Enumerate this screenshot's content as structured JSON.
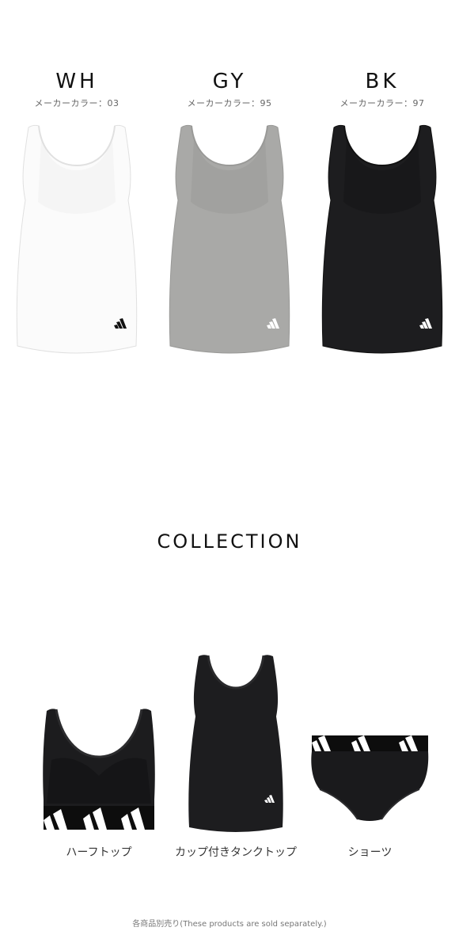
{
  "colors": [
    {
      "code": "WH",
      "maker_color": "メーカーカラー：03",
      "fill": "#fbfbfb",
      "inner": "#f2f2f2",
      "stroke": "#e0e0e0",
      "logo": "#111111"
    },
    {
      "code": "GY",
      "maker_color": "メーカーカラー：95",
      "fill": "#a9a9a7",
      "inner": "#9c9c9a",
      "stroke": "#999997",
      "logo": "#ffffff"
    },
    {
      "code": "BK",
      "maker_color": "メーカーカラー：97",
      "fill": "#1d1d1f",
      "inner": "#151517",
      "stroke": "#111111",
      "logo": "#ffffff"
    }
  ],
  "collection": {
    "title": "COLLECTION",
    "items": [
      {
        "label": "ハーフトップ",
        "icon": "half-top"
      },
      {
        "label": "カップ付きタンクトップ",
        "icon": "cup-tank-top"
      },
      {
        "label": "ショーツ",
        "icon": "shorts"
      }
    ]
  },
  "footnote": "各商品別売り(These products are sold separately.)"
}
